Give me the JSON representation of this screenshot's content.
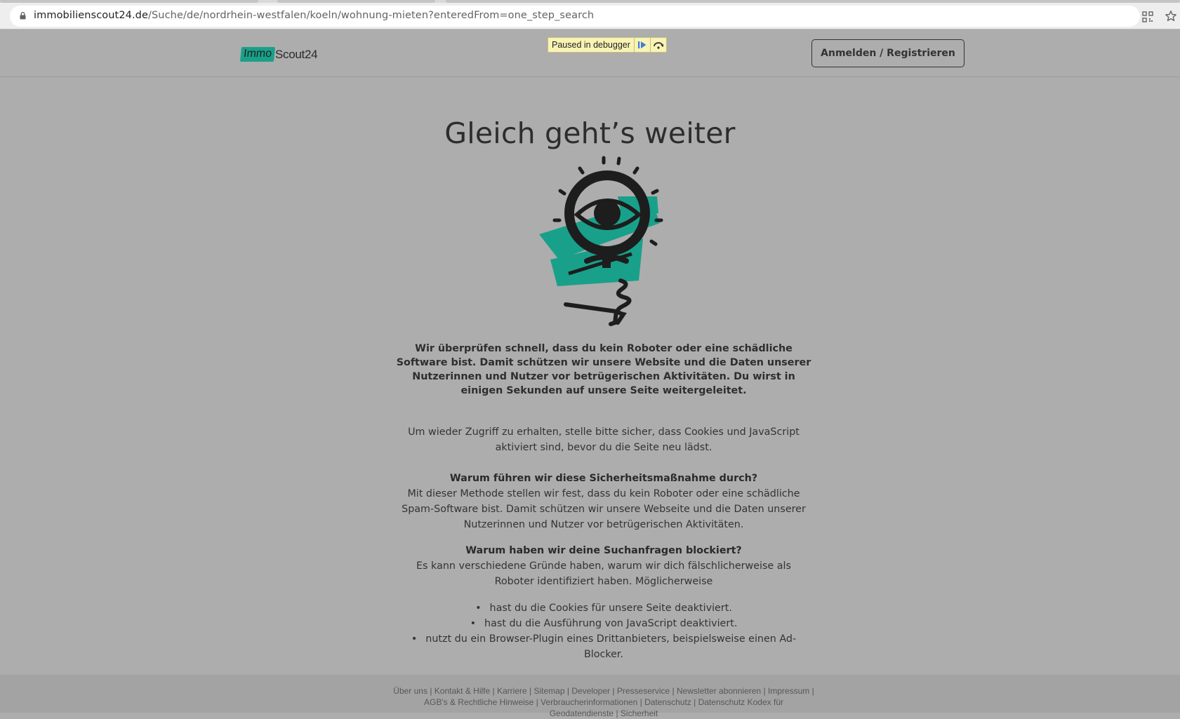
{
  "browser": {
    "url_host": "immobilienscout24.de",
    "url_path": "/Suche/de/nordrhein-westfalen/koeln/wohnung-mieten?enteredFrom=one_step_search",
    "icons": [
      "lock-icon",
      "qr-code-icon",
      "bookmark-star-icon"
    ]
  },
  "header": {
    "logo_immo": "Immo",
    "logo_scout": "Scout24",
    "debugger_text": "Paused in debugger",
    "login_label": "Anmelden / Registrieren"
  },
  "main": {
    "headline": "Gleich geht’s weiter",
    "lead": "Wir überprüfen schnell, dass du kein Roboter oder eine schädliche Software bist. Damit schützen wir unsere Website und die Daten unserer Nutzerinnen und Nutzer vor betrügerischen Aktivitäten. Du wirst in einigen Sekunden auf unsere Seite weitergeleitet.",
    "info": "Um wieder Zugriff zu erhalten, stelle bitte sicher, dass Cookies und JavaScript aktiviert sind, bevor du die Seite neu lädst.",
    "q1_title": "Warum führen wir diese Sicherheitsmaßnahme durch?",
    "q1_text": "Mit dieser Methode stellen wir fest, dass du kein Roboter oder eine schädliche Spam-Software bist. Damit schützen wir unsere Webseite und die Daten unserer Nutzerinnen und Nutzer vor betrügerischen Aktivitäten.",
    "q2_title": "Warum haben wir deine Suchanfragen blockiert?",
    "q2_text": "Es kann verschiedene Gründe haben, warum wir dich fälschlicherweise als Roboter identifiziert haben. Möglicherweise",
    "reasons": [
      "hast du die Cookies für unsere Seite deaktiviert.",
      "hast du die Ausführung von JavaScript deaktiviert.",
      "nutzt du ein Browser-Plugin eines Drittanbieters, beispielsweise einen Ad-Blocker."
    ]
  },
  "footer": {
    "links": [
      "Über uns",
      "Kontakt & Hilfe",
      "Karriere",
      "Sitemap",
      "Developer",
      "Presseservice",
      "Newsletter abonnieren",
      "Impressum",
      "AGB's & Rechtliche Hinweise",
      "Verbraucherinformationen",
      "Datenschutz",
      "Datenschutz Kodex für Geodatendienste",
      "Sicherheit"
    ]
  },
  "colors": {
    "page_background": "#adadad",
    "brand_teal": "#19a08a",
    "debugger_yellow": "#f9f3b5"
  }
}
